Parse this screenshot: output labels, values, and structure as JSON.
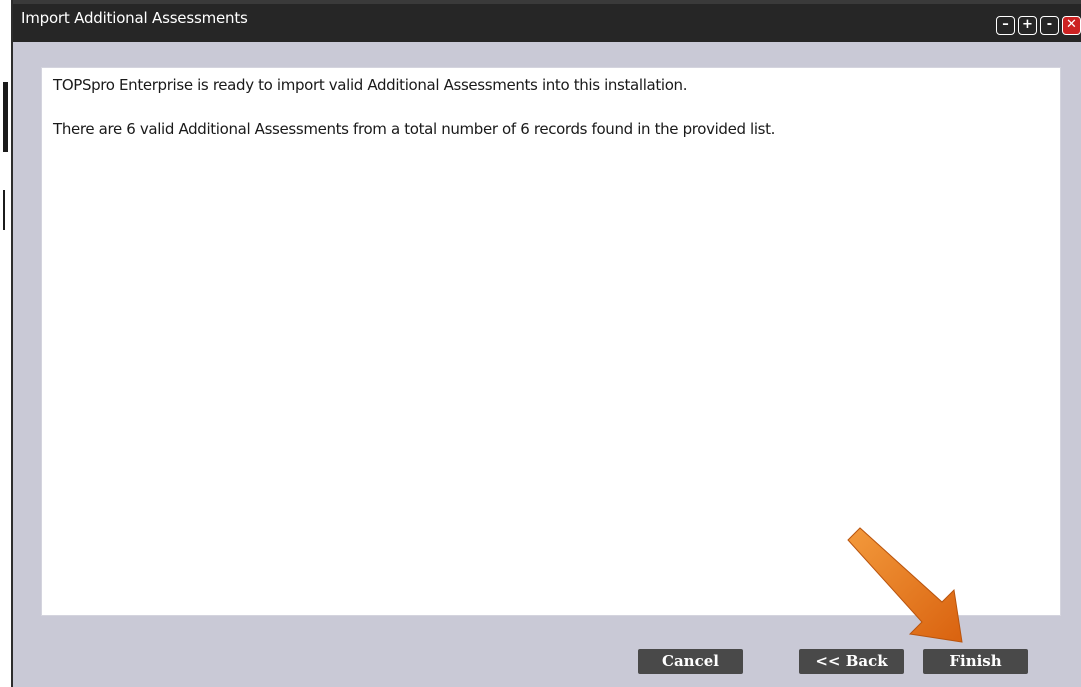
{
  "window": {
    "title": "Import Additional Assessments",
    "controls": [
      {
        "symbol": "–",
        "icon": "minimize-icon"
      },
      {
        "symbol": "+",
        "icon": "maximize-icon"
      },
      {
        "symbol": "-",
        "icon": "restore-icon"
      },
      {
        "symbol": "✕",
        "icon": "close-icon"
      }
    ]
  },
  "content": {
    "line1": "TOPSpro Enterprise is ready to import valid Additional Assessments into this installation.",
    "line2": "There are 6 valid Additional Assessments from a total number of 6 records found in the provided list."
  },
  "buttons": {
    "cancel": "Cancel",
    "back": "<< Back",
    "finish": "Finish"
  },
  "colors": {
    "titlebar": "#262626",
    "background": "#c9c9d6",
    "button": "#494949",
    "arrow": "#e8771c",
    "close": "#cc2222"
  }
}
